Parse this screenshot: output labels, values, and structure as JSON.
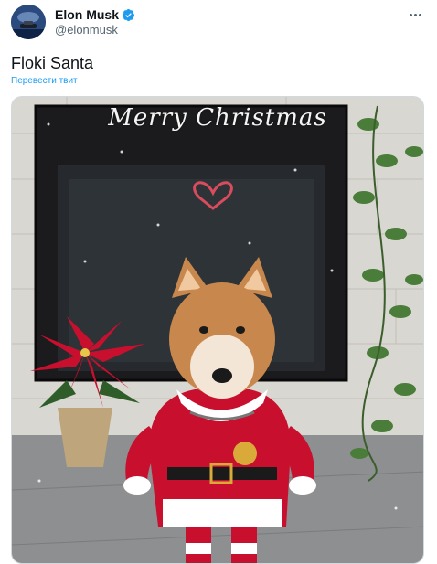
{
  "author": {
    "name": "Elon Musk",
    "handle": "@elonmusk",
    "verified": true,
    "avatar_icon": "avatar-rocket-image"
  },
  "tweet": {
    "text": "Floki Santa",
    "translate_label": "Перевести твит"
  },
  "media": {
    "sign_text": "Merry Christmas",
    "description_icon": "photo-dog-in-santa-costume"
  },
  "actions": {
    "more_icon": "more-horizontal-icon"
  },
  "colors": {
    "link_blue": "#1d9bf0",
    "verified_blue": "#1d9bf0",
    "secondary_text": "#536471",
    "santa_red": "#c8102e"
  }
}
